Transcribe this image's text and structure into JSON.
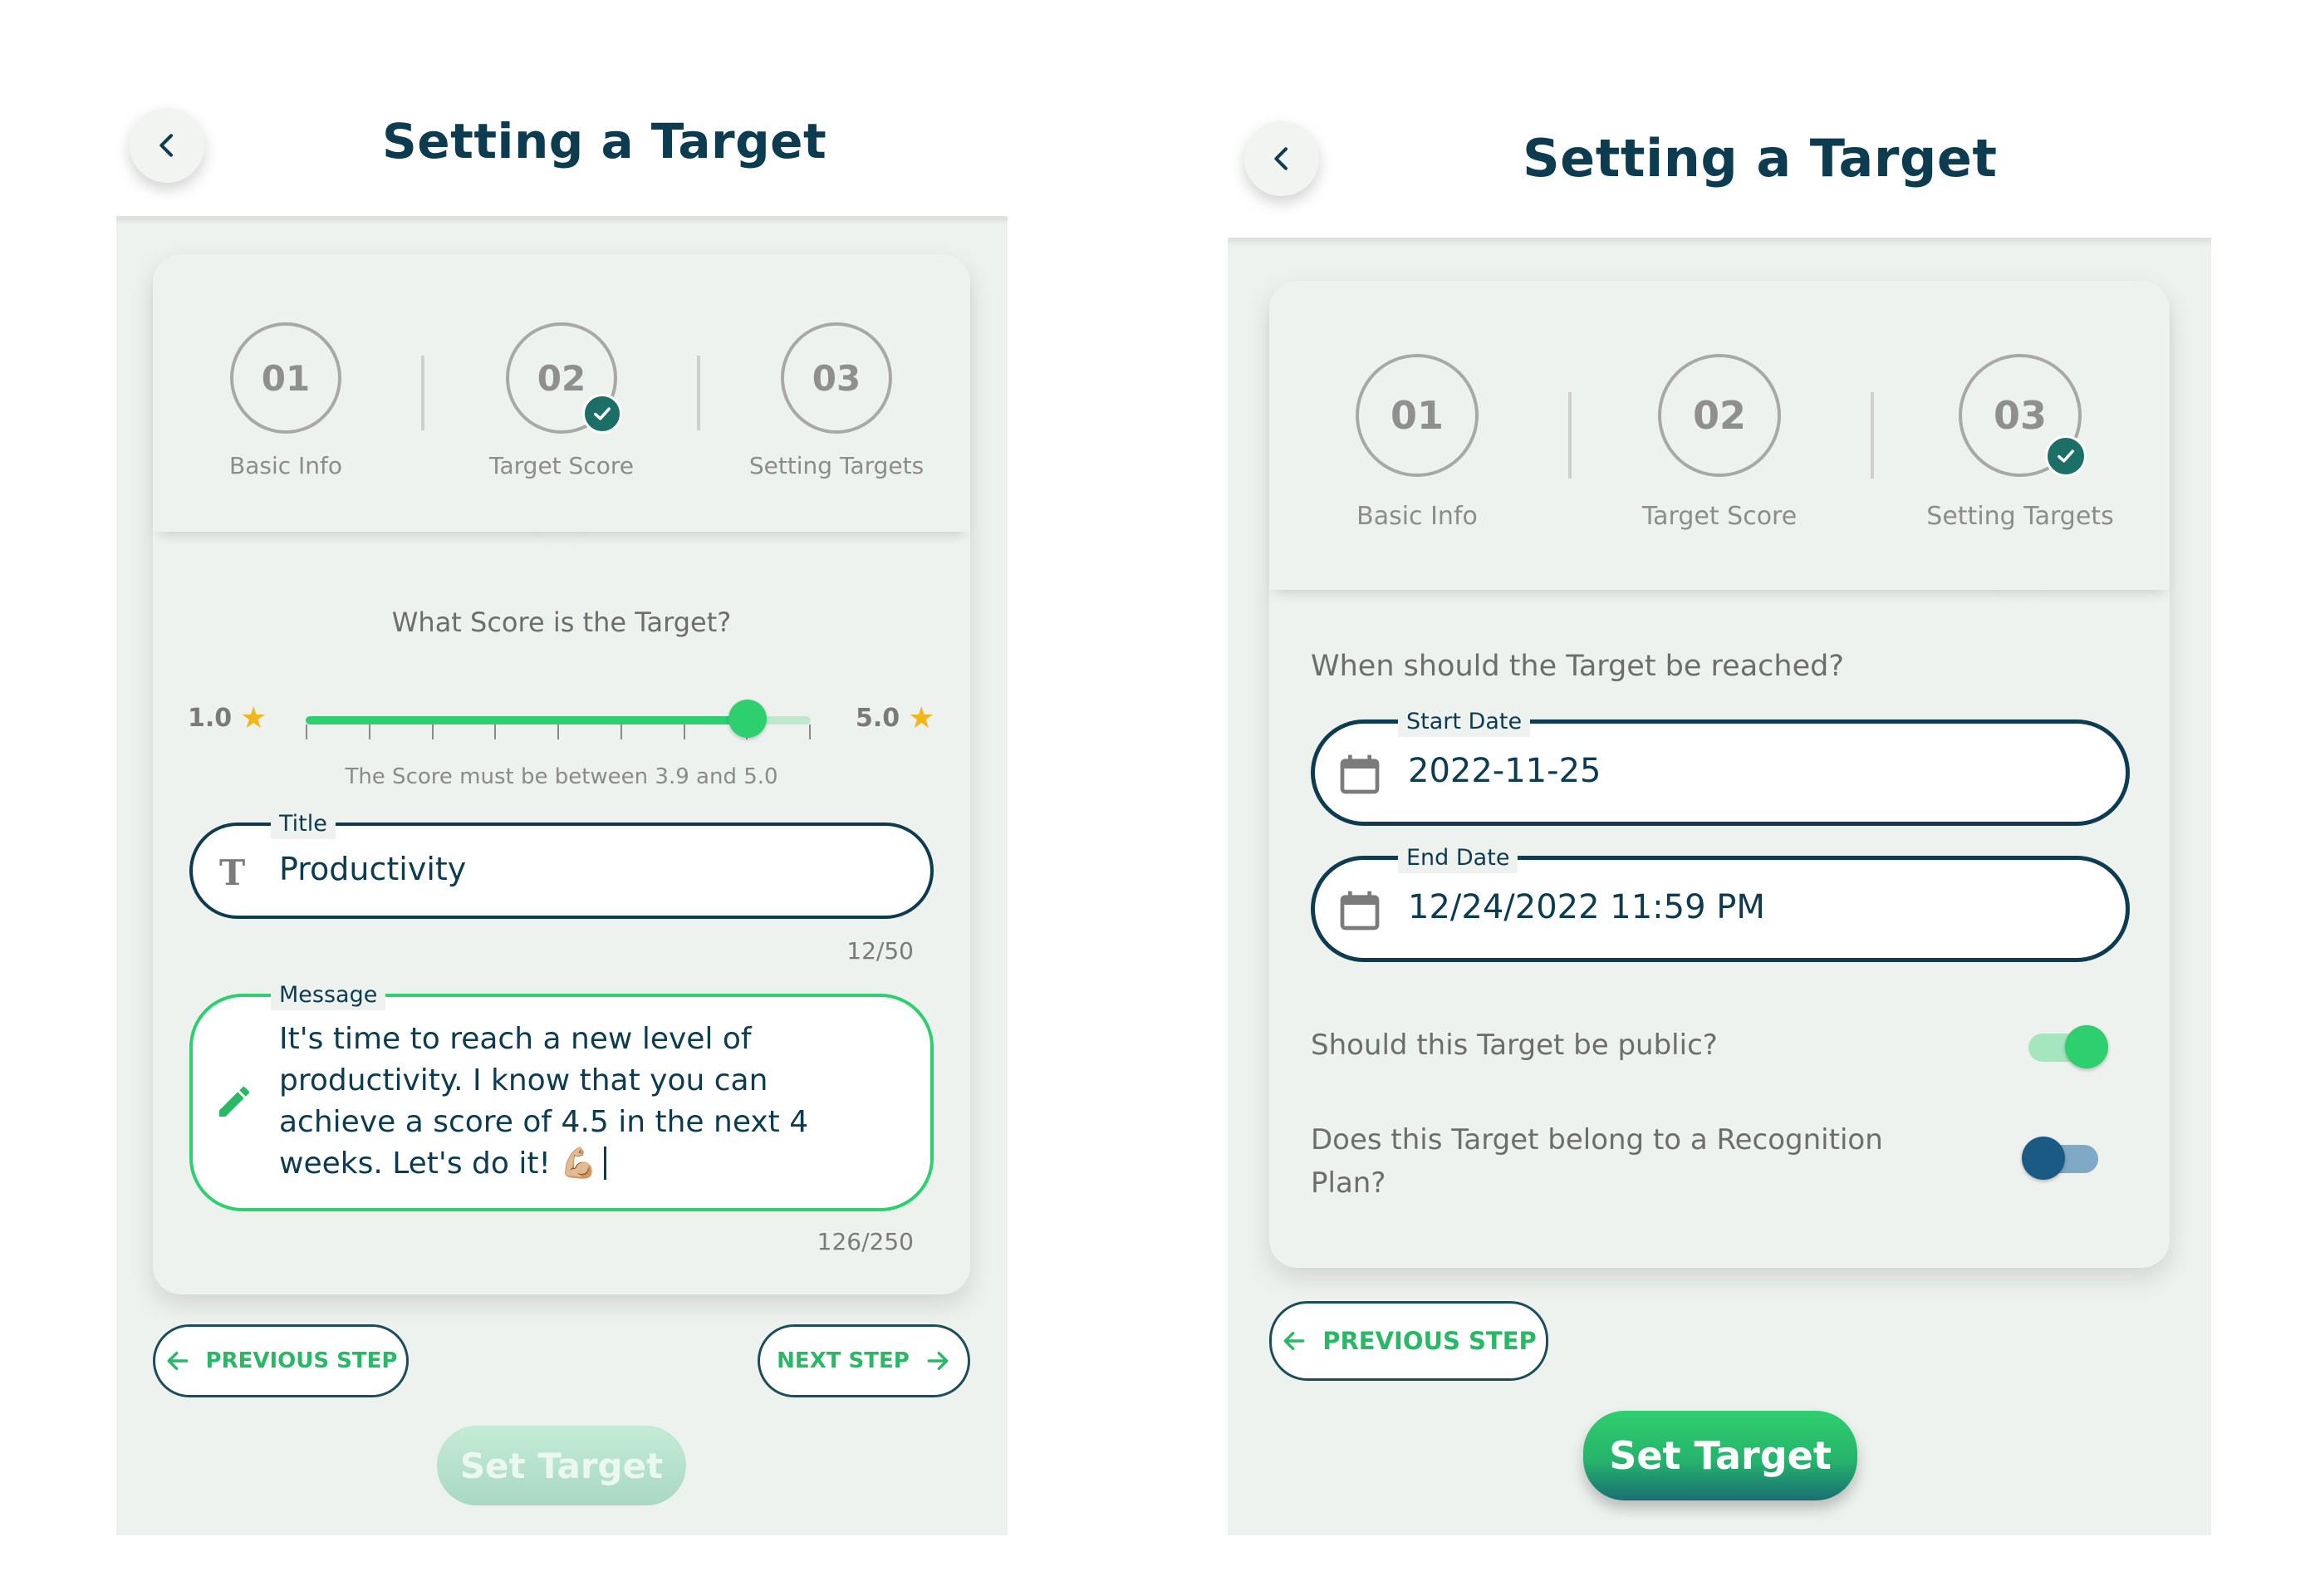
{
  "screen_a": {
    "title": "Setting a Target",
    "steps": [
      {
        "number": "01",
        "label": "Basic Info"
      },
      {
        "number": "02",
        "label": "Target Score"
      },
      {
        "number": "03",
        "label": "Setting Targets"
      }
    ],
    "completed_step": "02",
    "question": "What Score is the Target?",
    "slider": {
      "min_label": "1.0",
      "max_label": "5.0",
      "min": 1.0,
      "max": 5.0,
      "value": 4.5,
      "icon": "star-icon",
      "fill_color": "#2ecf6e"
    },
    "helper": "The Score must be between 3.9 and 5.0",
    "title_field": {
      "legend": "Title",
      "value": "Productivity",
      "counter": "12/50",
      "icon": "text-format-icon"
    },
    "message_field": {
      "legend": "Message",
      "value": "It's time to reach a new level of productivity. I know that you can achieve a score of 4.5 in the next 4 weeks. Let's do it! 💪🏼",
      "counter": "126/250",
      "icon": "pencil-icon"
    },
    "prev_button": "PREVIOUS STEP",
    "next_button": "NEXT STEP",
    "set_target_button": "Set Target"
  },
  "screen_b": {
    "title": "Setting a Target",
    "steps": [
      {
        "number": "01",
        "label": "Basic Info"
      },
      {
        "number": "02",
        "label": "Target Score"
      },
      {
        "number": "03",
        "label": "Setting Targets"
      }
    ],
    "completed_step": "03",
    "question": "When should the Target be reached?",
    "start_date": {
      "legend": "Start Date",
      "value": "2022-11-25",
      "icon": "calendar-icon"
    },
    "end_date": {
      "legend": "End Date",
      "value": "12/24/2022 11:59 PM",
      "icon": "calendar-icon"
    },
    "public_toggle": {
      "label": "Should this Target be public?",
      "on": true,
      "color": "#2ecf6e"
    },
    "recognition_toggle": {
      "label": "Does this Target belong to a Recognition Plan?",
      "on": false,
      "color": "#1c5a86"
    },
    "prev_button": "PREVIOUS STEP",
    "set_target_button": "Set Target"
  },
  "colors": {
    "accent": "#2ecf6e",
    "navy": "#0d3b4f",
    "badge": "#1c6f66",
    "background": "#eef2ee"
  }
}
